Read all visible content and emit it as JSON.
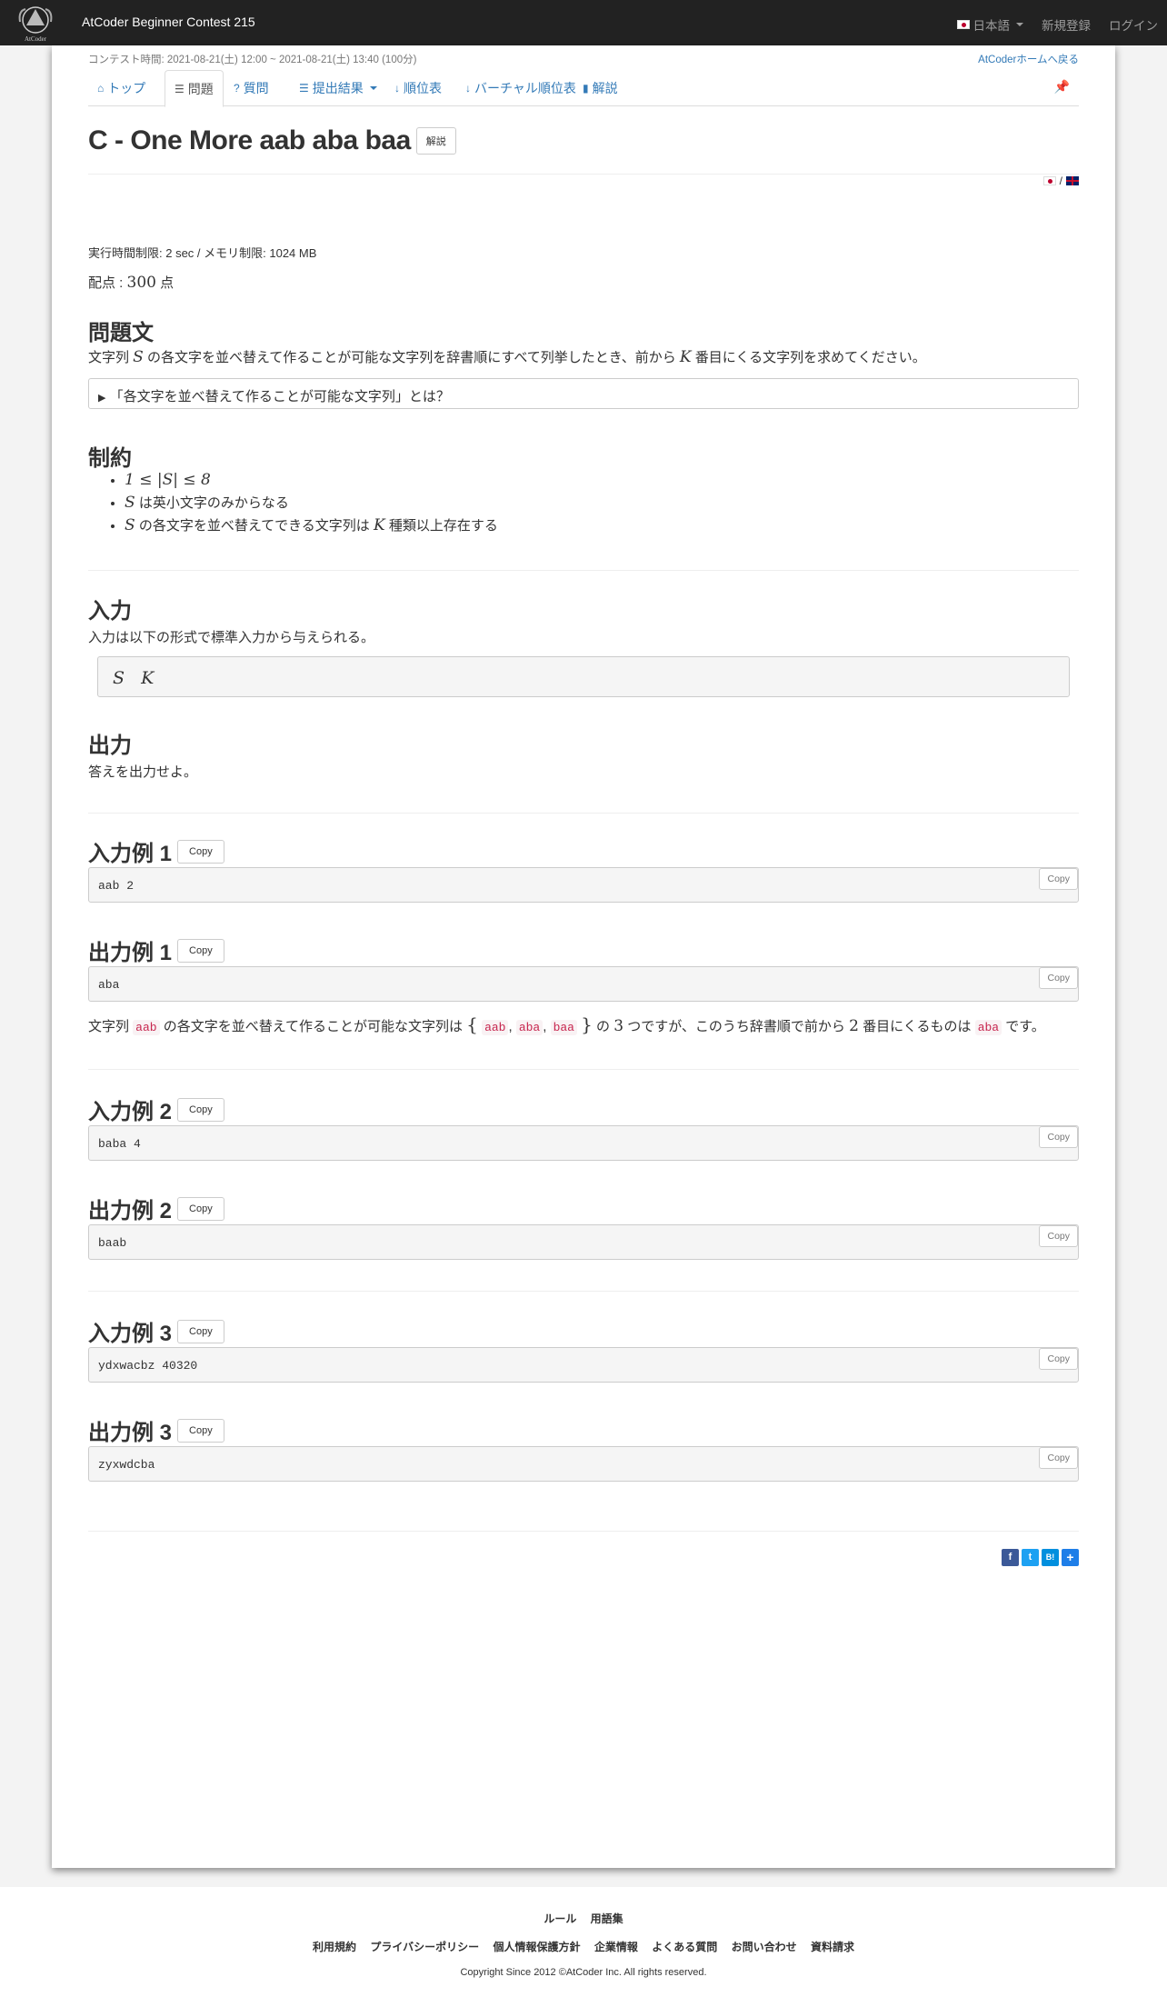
{
  "navbar": {
    "brand": "AtCoder Beginner Contest 215",
    "language": "日本語",
    "register": "新規登録",
    "login": "ログイン"
  },
  "contest": {
    "time": "コンテスト時間: 2021-08-21(土) 12:00 ~ 2021-08-21(土) 13:40 (100分)",
    "home_link": "AtCoderホームへ戻る"
  },
  "tabs": [
    "トップ",
    "問題",
    "質問",
    "提出結果",
    "順位表",
    "バーチャル順位表",
    "解説"
  ],
  "problem": {
    "title": "C - One More aab aba baa",
    "editorial_button": "解説",
    "lang_sep": "/",
    "limits": "実行時間制限: 2 sec / メモリ制限: 1024 MB",
    "score_prefix": "配点 : ",
    "score_value": "300",
    "score_suffix": " 点"
  },
  "statement": {
    "heading": "問題文",
    "t1": "文字列 ",
    "s_var": "S",
    "t2": " の各文字を並べ替えて作ることが可能な文字列を辞書順にすべて列挙したとき、前から ",
    "k_var": "K",
    "t3": " 番目にくる文字列を求めてください。",
    "details": "「各文字を並べ替えて作ることが可能な文字列」とは？"
  },
  "constraints": {
    "heading": "制約",
    "c1": "1 ≤ |S| ≤ 8",
    "c2_var": "S",
    "c2": " は英小文字のみからなる",
    "c3_var": "S",
    "c3a": " の各文字を並べ替えてできる文字列は ",
    "c3_k": "K",
    "c3b": " 種類以上存在する"
  },
  "input": {
    "heading": "入力",
    "text": "入力は以下の形式で標準入力から与えられる。",
    "format": "S   K"
  },
  "output": {
    "heading": "出力",
    "text": "答えを出力せよ。"
  },
  "copy_label": "Copy",
  "samples": [
    {
      "in_label": "入力例 1",
      "in": "aab 2",
      "out_label": "出力例 1",
      "out": "aba"
    },
    {
      "in_label": "入力例 2",
      "in": "baba 4",
      "out_label": "出力例 2",
      "out": "baab"
    },
    {
      "in_label": "入力例 3",
      "in": "ydxwacbz 40320",
      "out_label": "出力例 3",
      "out": "zyxwdcba"
    }
  ],
  "explanation": {
    "a": "文字列 ",
    "s": "aab",
    "b": " の各文字を並べ替えて作ることが可能な文字列は ",
    "lb": "{",
    "x1": "aab",
    "x2": "aba",
    "x3": "baa",
    "rb": "}",
    "c": " の ",
    "n3": "3",
    "d": " つですが、このうち辞書順で前から ",
    "n2": "2",
    "e": " 番目にくるものは ",
    "ans": "aba",
    "f": " です。"
  },
  "share": [
    "f",
    "t",
    "B!",
    "+"
  ],
  "footer": {
    "row1": [
      "ルール",
      "用語集"
    ],
    "row2": [
      "利用規約",
      "プライバシーポリシー",
      "個人情報保護方針",
      "企業情報",
      "よくある質問",
      "お問い合わせ",
      "資料請求"
    ],
    "copyright": "Copyright Since 2012 ©AtCoder Inc. All rights reserved."
  },
  "colors": {
    "link": "#337ab7",
    "navbar": "#222222",
    "code": "#c7254e"
  }
}
